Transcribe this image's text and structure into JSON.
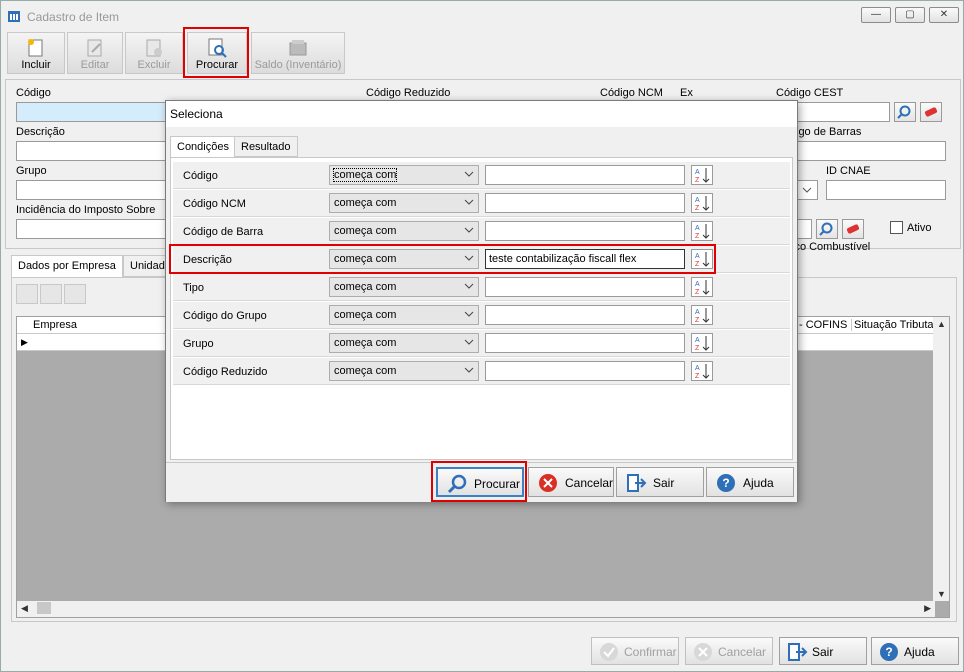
{
  "window": {
    "title": "Cadastro de Item",
    "min_label": "—",
    "max_label": "▢",
    "close_label": "✕"
  },
  "toolbar": {
    "incluir": "Incluir",
    "editar": "Editar",
    "excluir": "Excluir",
    "procurar": "Procurar",
    "saldo": "Saldo (Inventário)"
  },
  "form": {
    "codigo_label": "Código",
    "codigo_reduzido_label": "Código Reduzido",
    "codigo_ncm_label": "Código NCM",
    "ex_label": "Ex",
    "codigo_cest_label": "Código CEST",
    "descricao_label": "Descrição",
    "codigo_barras_label": "igo de Barras",
    "grupo_label": "Grupo",
    "id_cnae_label": "ID CNAE",
    "incidencia_label": "Incidência do Imposto Sobre",
    "ativo_label": "Ativo",
    "combustivel_label": "ico Combustível"
  },
  "tabs": {
    "dados_empresa": "Dados por Empresa",
    "unidade": "Unidad"
  },
  "grid": {
    "columns": [
      "Empresa",
      "- COFINS",
      "Situação Tributa"
    ]
  },
  "footer": {
    "confirmar": "Confirmar",
    "cancelar": "Cancelar",
    "sair": "Sair",
    "ajuda": "Ajuda"
  },
  "modal": {
    "title": "Seleciona",
    "tabs": [
      "Condições",
      "Resultado"
    ],
    "conditions": [
      {
        "label": "Código",
        "operator": "começa com",
        "value": ""
      },
      {
        "label": "Código NCM",
        "operator": "começa com",
        "value": ""
      },
      {
        "label": "Código de Barra",
        "operator": "começa com",
        "value": ""
      },
      {
        "label": "Descrição",
        "operator": "começa com",
        "value": "teste contabilização fiscall flex"
      },
      {
        "label": "Tipo",
        "operator": "começa com",
        "value": ""
      },
      {
        "label": "Código do Grupo",
        "operator": "começa com",
        "value": ""
      },
      {
        "label": "Grupo",
        "operator": "começa com",
        "value": ""
      },
      {
        "label": "Código Reduzido",
        "operator": "começa com",
        "value": ""
      }
    ],
    "buttons": {
      "procurar": "Procurar",
      "cancelar": "Cancelar",
      "sair": "Sair",
      "ajuda": "Ajuda"
    }
  },
  "colors": {
    "highlight_red": "#e00000",
    "field_focus_blue": "#d4ecfb",
    "primary_border": "#3b82c4"
  }
}
